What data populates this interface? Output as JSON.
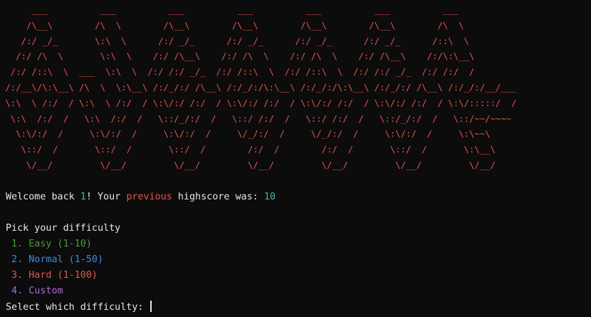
{
  "banner": {
    "lines": [
      "      ___          ___          ___          ___          ___          ___          ___",
      "     /\\__\\        /\\  \\        /\\__\\        /\\__\\        /\\__\\        /\\__\\        /\\  \\",
      "    /:/ _/_       \\:\\  \\      /:/ _/_      /:/ _/_      /:/ _/_      /:/ _/_      /::\\  \\",
      "   /:/ /\\  \\       \\:\\  \\    /:/ /\\__\\    /:/ /\\  \\    /:/ /\\  \\    /:/ /\\__\\    /:/\\:\\__\\",
      "  /:/ /::\\  \\  ___  \\:\\  \\  /:/ /:/ _/_  /:/ /::\\  \\  /:/ /::\\  \\  /:/ /:/ _/_  /:/ /:/  /",
      " /:/__\\/\\:\\__\\ /\\  \\  \\:\\__\\ /:/_/:/ /\\__\\ /:/_/:/\\:\\__\\ /:/_/:/\\:\\__\\ /:/_/:/ /\\__\\ /:/_/:/__/___",
      " \\:\\  \\ /:/  / \\:\\  \\ /:/  / \\:\\/:/ /:/  / \\:\\/:/ /:/  / \\:\\/:/ /:/  / \\:\\/:/ /:/  / \\:\\/:::::/  /",
      "  \\:\\  /:/  /   \\:\\  /:/  /   \\::/_/:/  /   \\::/ /:/  /   \\::/ /:/  /   \\::/_/:/  /   \\::/~~/~~~~",
      "   \\:\\/:/  /     \\:\\/:/  /     \\:\\/:/  /     \\/_/:/  /     \\/_/:/  /     \\:\\/:/  /     \\:\\~~\\",
      "    \\::/  /       \\::/  /       \\::/  /        /:/  /        /:/  /       \\::/  /       \\:\\__\\",
      "     \\/__/         \\/__/         \\/__/         \\/__/         \\/__/         \\/__/         \\/__/"
    ]
  },
  "welcome": {
    "prefix": "Welcome back ",
    "user": "1",
    "mid": "! Your ",
    "highlight": "previous",
    "suffix": " highscore was: ",
    "score": "10"
  },
  "menu": {
    "prompt": "Pick your difficulty",
    "options": [
      {
        "label": " 1. Easy (1-10)"
      },
      {
        "label": " 2. Normal (1-50)"
      },
      {
        "label": " 3. Hard (1-100)"
      },
      {
        "label": " 4. Custom"
      }
    ]
  },
  "input": {
    "prompt": "Select which difficulty: ",
    "value": ""
  },
  "colors": {
    "background": "#0c0c0c",
    "text": "#e6e6e6",
    "banner": "#e8554e",
    "number": "#3fb6b6",
    "easy": "#4e9a3a",
    "normal": "#3a8fdc",
    "hard": "#e8554e",
    "custom": "#b366d8"
  }
}
